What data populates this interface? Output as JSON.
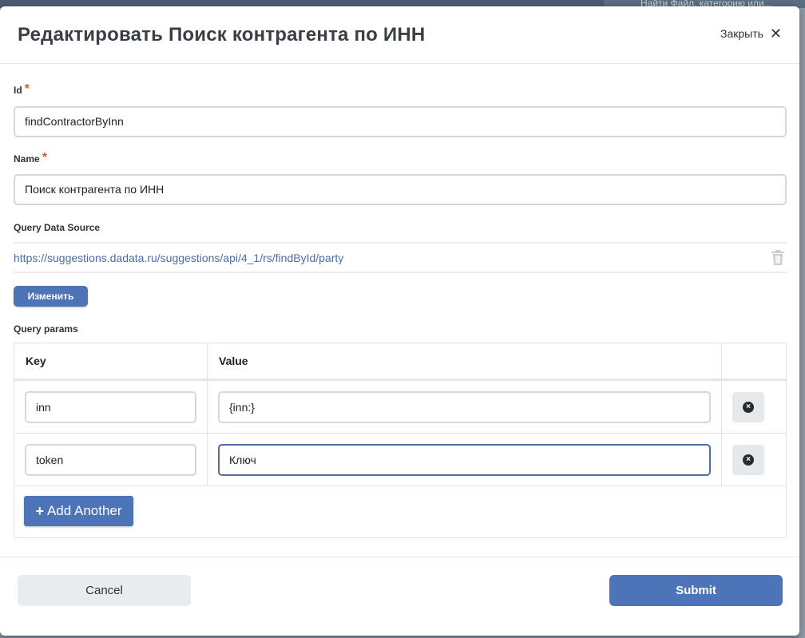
{
  "backdrop": {
    "search_hint": "Найти Файл, категорию или..."
  },
  "modal": {
    "title": "Редактировать Поиск контрагента по ИНН",
    "close_label": "Закрыть",
    "close_glyph": "✕"
  },
  "form": {
    "id": {
      "label": "Id",
      "required_mark": "*",
      "value": "findContractorByInn"
    },
    "name": {
      "label": "Name",
      "required_mark": "*",
      "value": "Поиск контрагента по ИНН"
    },
    "data_source": {
      "label": "Query Data Source",
      "url": "https://suggestions.dadata.ru/suggestions/api/4_1/rs/findById/party",
      "change_button": "Изменить"
    },
    "query_params": {
      "label": "Query params",
      "columns": {
        "key": "Key",
        "value": "Value"
      },
      "rows": [
        {
          "key": "inn",
          "value": "{inn:}"
        },
        {
          "key": "token",
          "value": "Ключ"
        }
      ],
      "add_button": "Add Another",
      "add_icon": "+",
      "remove_icon": "×"
    }
  },
  "footer": {
    "cancel": "Cancel",
    "submit": "Submit"
  },
  "colors": {
    "primary": "#4d74b7",
    "required": "#e05a2b",
    "link": "#4a6fa5"
  }
}
